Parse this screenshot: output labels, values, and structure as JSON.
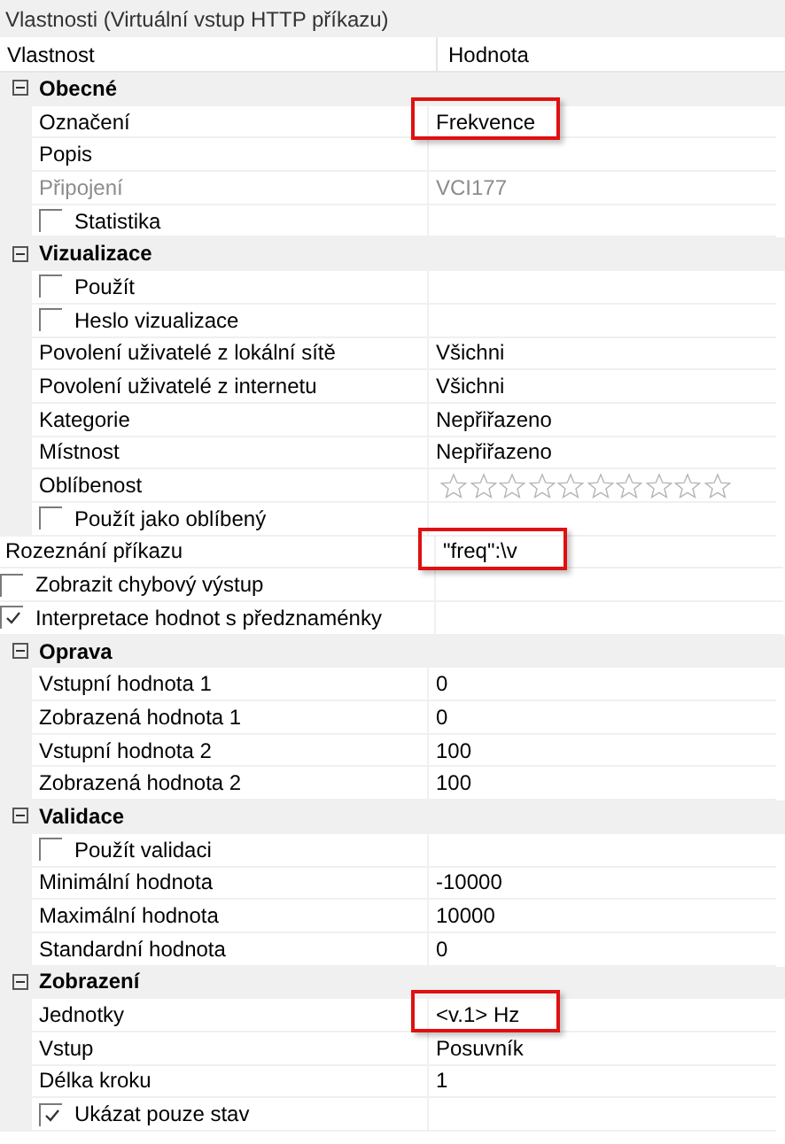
{
  "panel_title": "Vlastnosti (Virtuální vstup HTTP příkazu)",
  "columns": [
    "Vlastnost",
    "Hodnota"
  ],
  "items": [
    {
      "kind": "category",
      "label": "Obecné",
      "expanded": true,
      "children": [
        {
          "kind": "property",
          "label": "Označení",
          "value": "Frekvence",
          "highlighted": true,
          "disabled": false
        },
        {
          "kind": "property",
          "label": "Popis",
          "disabled": false
        },
        {
          "kind": "property",
          "label": "Připojení",
          "value": "VCI177",
          "disabled": true
        },
        {
          "kind": "checkbox",
          "label": "Statistika",
          "checked": false
        }
      ]
    },
    {
      "kind": "category",
      "label": "Vizualizace",
      "expanded": true,
      "children": [
        {
          "kind": "checkbox",
          "label": "Použít",
          "checked": false
        },
        {
          "kind": "checkbox",
          "label": "Heslo vizualizace",
          "checked": false
        },
        {
          "kind": "property",
          "label": "Povolení uživatelé z lokální sítě",
          "value": "Všichni",
          "disabled": false
        },
        {
          "kind": "property",
          "label": "Povolení uživatelé z internetu",
          "value": "Všichni",
          "disabled": false
        },
        {
          "kind": "property",
          "label": "Kategorie",
          "value": "Nepřiřazeno",
          "disabled": false
        },
        {
          "kind": "property",
          "label": "Místnost",
          "value": "Nepřiřazeno",
          "disabled": false
        },
        {
          "kind": "stars",
          "label": "Oblíbenost",
          "stars": 0
        },
        {
          "kind": "checkbox",
          "label": "Použít jako oblíbený",
          "checked": false
        }
      ]
    },
    {
      "kind": "property",
      "label": "Rozeznání příkazu",
      "value": "\"freq\":\\v",
      "highlighted": true,
      "disabled": false
    },
    {
      "kind": "checkbox",
      "label": "Zobrazit chybový výstup",
      "checked": false
    },
    {
      "kind": "checkbox",
      "label": "Interpretace hodnot s předznaménky",
      "checked": true
    },
    {
      "kind": "category",
      "label": "Oprava",
      "expanded": true,
      "children": [
        {
          "kind": "property",
          "label": "Vstupní hodnota 1",
          "value": "0",
          "disabled": false
        },
        {
          "kind": "property",
          "label": "Zobrazená hodnota 1",
          "value": "0",
          "disabled": false
        },
        {
          "kind": "property",
          "label": "Vstupní hodnota 2",
          "value": "100",
          "disabled": false
        },
        {
          "kind": "property",
          "label": "Zobrazená hodnota 2",
          "value": "100",
          "disabled": false
        }
      ]
    },
    {
      "kind": "category",
      "label": "Validace",
      "expanded": true,
      "children": [
        {
          "kind": "checkbox",
          "label": "Použít validaci",
          "checked": false
        },
        {
          "kind": "property",
          "label": "Minimální hodnota",
          "value": "-10000",
          "disabled": false
        },
        {
          "kind": "property",
          "label": "Maximální hodnota",
          "value": "10000",
          "disabled": false
        },
        {
          "kind": "property",
          "label": "Standardní hodnota",
          "value": "0",
          "disabled": false
        }
      ]
    },
    {
      "kind": "category",
      "label": "Zobrazení",
      "expanded": true,
      "children": [
        {
          "kind": "property",
          "label": "Jednotky",
          "value": "<v.1> Hz",
          "highlighted": true,
          "disabled": false
        },
        {
          "kind": "property",
          "label": "Vstup",
          "value": "Posuvník",
          "disabled": false
        },
        {
          "kind": "property",
          "label": "Délka kroku",
          "value": "1",
          "disabled": false
        },
        {
          "kind": "checkbox",
          "label": "Ukázat pouze stav",
          "checked": true
        }
      ]
    }
  ]
}
